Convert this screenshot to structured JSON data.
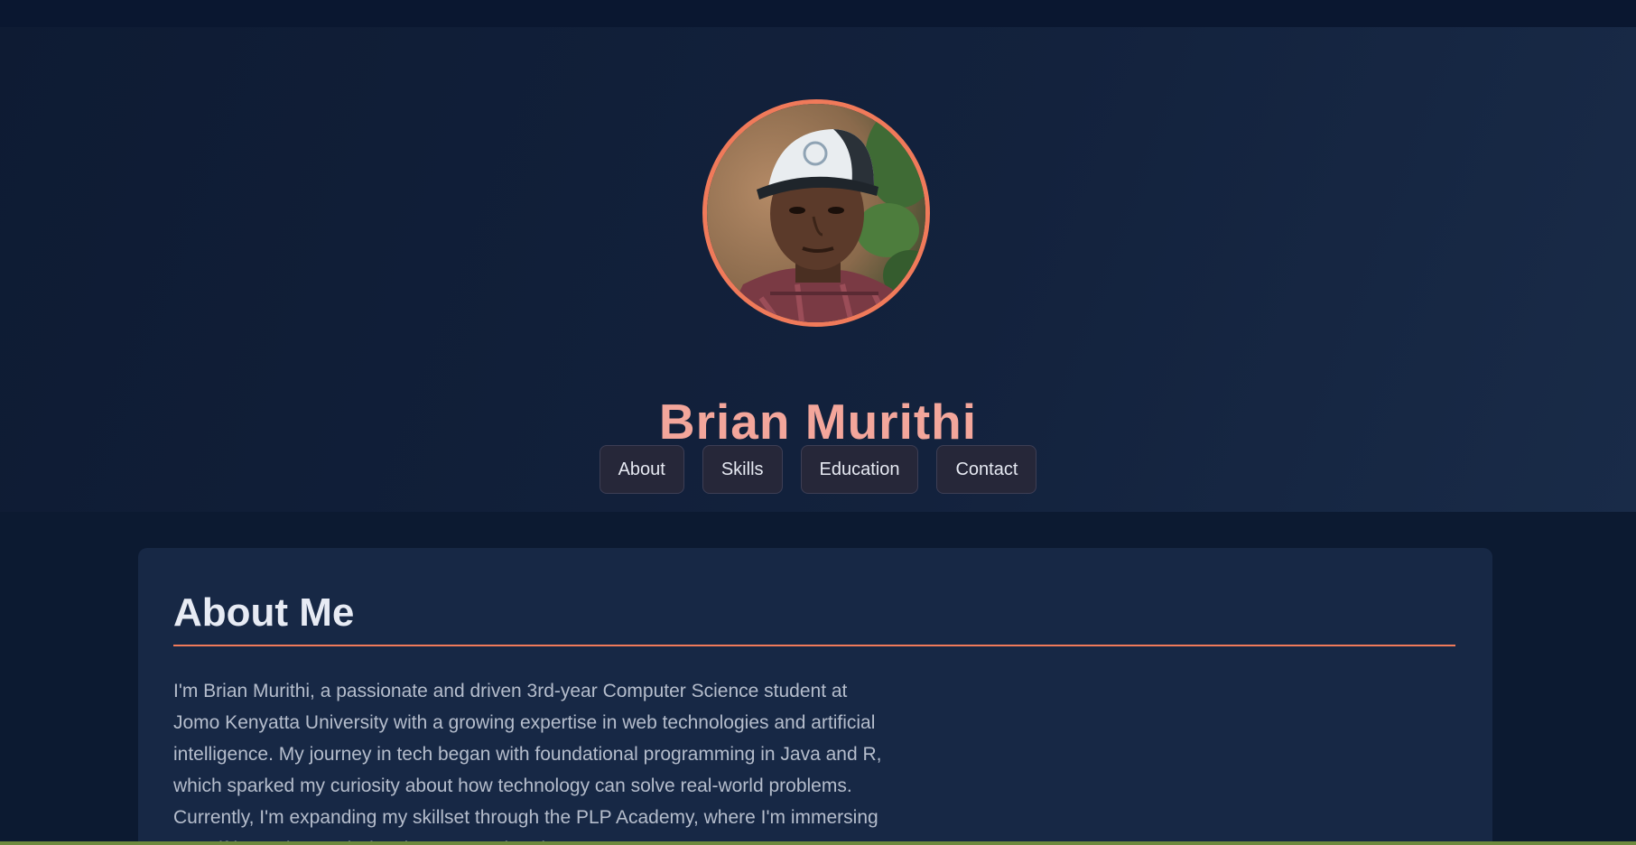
{
  "hero": {
    "name": "Brian Murithi"
  },
  "nav": {
    "items": [
      {
        "label": "About"
      },
      {
        "label": "Skills"
      },
      {
        "label": "Education"
      },
      {
        "label": "Contact"
      }
    ]
  },
  "about": {
    "title": "About Me",
    "body": "I'm Brian Murithi, a passionate and driven 3rd-year Computer Science student at Jomo Kenyatta University with a growing expertise in web technologies and artificial intelligence. My journey in tech began with foundational programming in Java and R, which sparked my curiosity about how technology can solve real-world problems. Currently, I'm expanding my skillset through the PLP Academy, where I'm immersing myself in modern web development and Python."
  },
  "colors": {
    "accent": "#f07a5a",
    "name": "#f3a69b",
    "background": "#0c1a31",
    "card": "#172845"
  }
}
